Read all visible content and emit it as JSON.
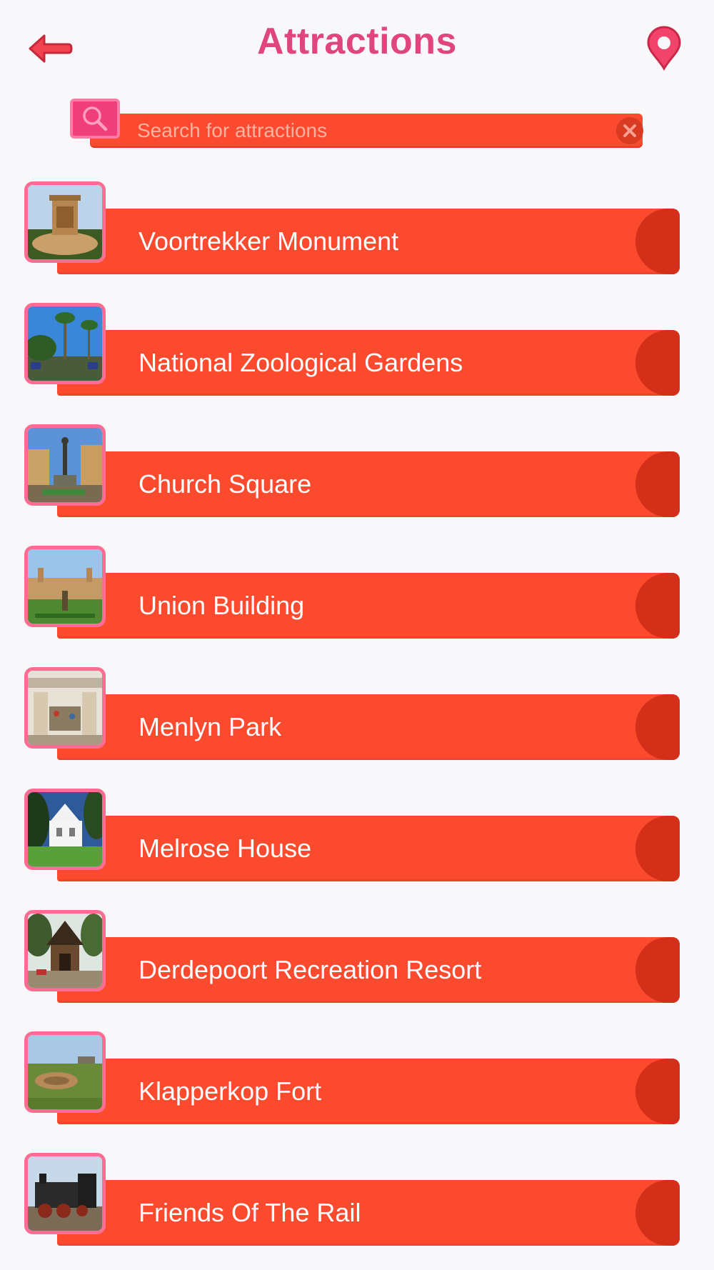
{
  "header": {
    "title": "Attractions",
    "back_icon": "back-arrow-icon",
    "location_icon": "map-pin-icon"
  },
  "search": {
    "placeholder": "Search for attractions",
    "value": "",
    "icon": "search-icon",
    "clear_icon": "close-icon"
  },
  "colors": {
    "accent": "#e0457e",
    "bar": "#fc4a2e",
    "bar_dark": "#d42f18",
    "thumb_border": "#ff6c93",
    "background": "#f8f8fa"
  },
  "attractions": [
    {
      "label": "Voortrekker Monument",
      "photo": "voortrekker-monument-photo"
    },
    {
      "label": "National Zoological Gardens",
      "photo": "zoo-gates-photo"
    },
    {
      "label": "Church Square",
      "photo": "church-square-photo"
    },
    {
      "label": "Union Building",
      "photo": "union-building-photo"
    },
    {
      "label": "Menlyn Park",
      "photo": "menlyn-mall-photo"
    },
    {
      "label": "Melrose House",
      "photo": "melrose-house-photo"
    },
    {
      "label": "Derdepoort Recreation Resort",
      "photo": "resort-lodge-photo"
    },
    {
      "label": "Klapperkop Fort",
      "photo": "klapperkop-fort-photo"
    },
    {
      "label": "Friends Of The Rail",
      "photo": "steam-train-photo"
    }
  ]
}
